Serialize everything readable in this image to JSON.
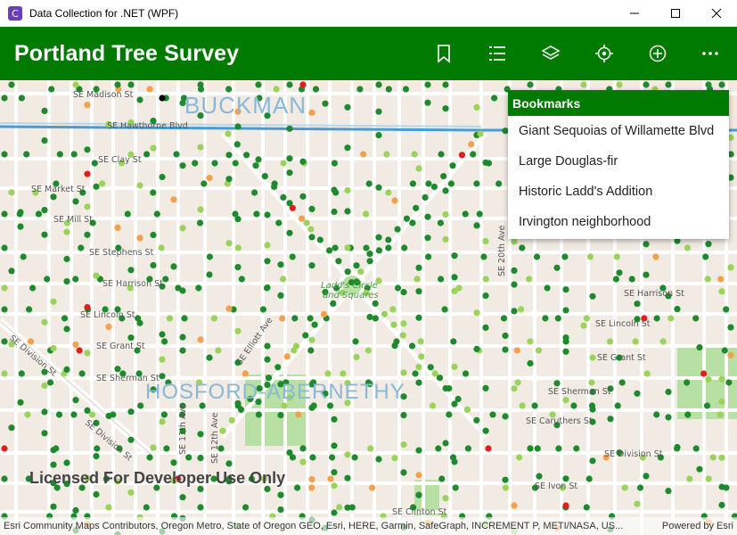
{
  "window": {
    "title": "Data Collection for .NET (WPF)"
  },
  "header": {
    "title": "Portland Tree Survey",
    "icons": [
      "bookmark-icon",
      "list-icon",
      "layers-icon",
      "locate-icon",
      "add-icon",
      "more-icon"
    ]
  },
  "bookmarks": {
    "header": "Bookmarks",
    "items": [
      {
        "label": "Giant Sequoias of Willamette Blvd"
      },
      {
        "label": "Large Douglas-fir"
      },
      {
        "label": "Historic Ladd's Addition"
      },
      {
        "label": "Irvington neighborhood"
      }
    ]
  },
  "map": {
    "neighborhoods": [
      "BUCKMAN",
      "HOSFORD-ABERNETHY"
    ],
    "streets": [
      "SE Madison St",
      "SE Hawthorne Blvd",
      "SE Clay St",
      "SE Market St",
      "SE Mill St",
      "SE Stephens St",
      "SE Harrison St",
      "SE Lincoln St",
      "SE Grant St",
      "SE Sherman St",
      "SE Division St",
      "SE Caruthers St",
      "SE Ivon St",
      "SE Clinton St",
      "SE 11th Ave",
      "SE 12th Ave",
      "SE 20th Ave",
      "SE Division St",
      "SE Elliott Ave",
      "SE Harrison St",
      "SE Lincoln St",
      "SE Grant St",
      "SE Sherman St",
      "SE Division St"
    ],
    "park_label_1": "Ladd's Circle",
    "park_label_2": "and Squares",
    "license": "Licensed For Developer Use Only"
  },
  "attribution": {
    "text": "Esri Community Maps Contributors, Oregon Metro, State of Oregon GEO, Esri, HERE, Garmin, SafeGraph, INCREMENT P, METI/NASA, US...",
    "powered": "Powered by Esri"
  },
  "colors": {
    "brand": "#007a00",
    "tree_dark": "#1e8a2e",
    "tree_light": "#9ad35a",
    "tree_orange": "#f5a04a",
    "tree_red": "#e01e1e"
  }
}
